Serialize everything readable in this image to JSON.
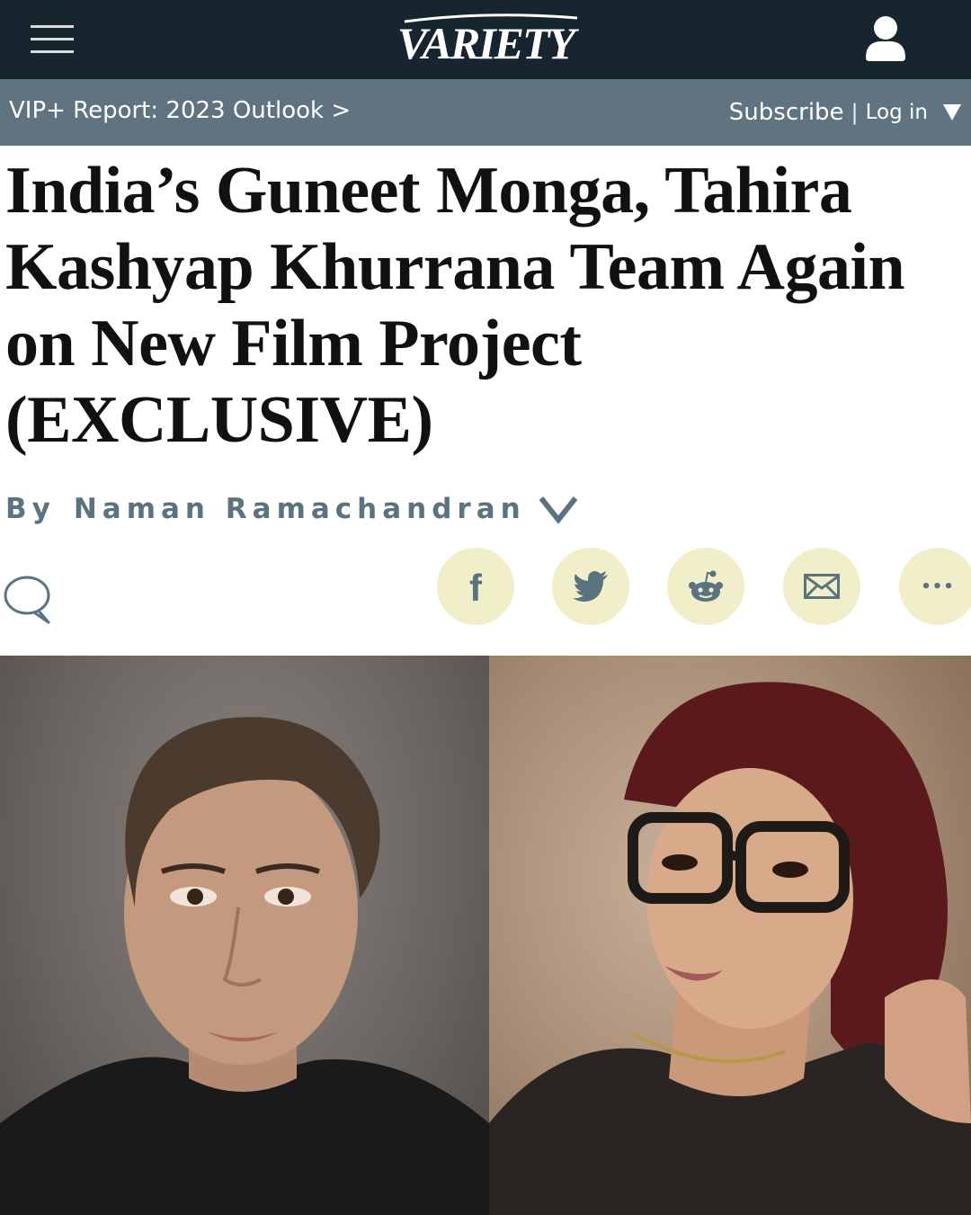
{
  "header": {
    "logo_text": "VARIETY",
    "menu_icon": "hamburger-menu-icon",
    "user_icon": "user-account-icon"
  },
  "subbar": {
    "vip_link": "VIP+ Report: 2023 Outlook >",
    "subscribe": "Subscribe",
    "separator": "|",
    "login": "Log in"
  },
  "article": {
    "title": "India’s Guneet Monga, Tahira Kashyap Khurrana Team Again on New Film Project (EXCLUSIVE)",
    "byline_prefix": "By",
    "author": "Naman Ramachandran"
  },
  "share": {
    "icons": [
      "comment-icon",
      "facebook-icon",
      "twitter-icon",
      "reddit-icon",
      "email-icon",
      "more-icon"
    ],
    "facebook_glyph": "f",
    "more_glyph": "•••"
  },
  "colors": {
    "topbar": "#17252e",
    "subbar": "#5f7480",
    "byline": "#5b7381",
    "share_button": "#f1efc9"
  }
}
